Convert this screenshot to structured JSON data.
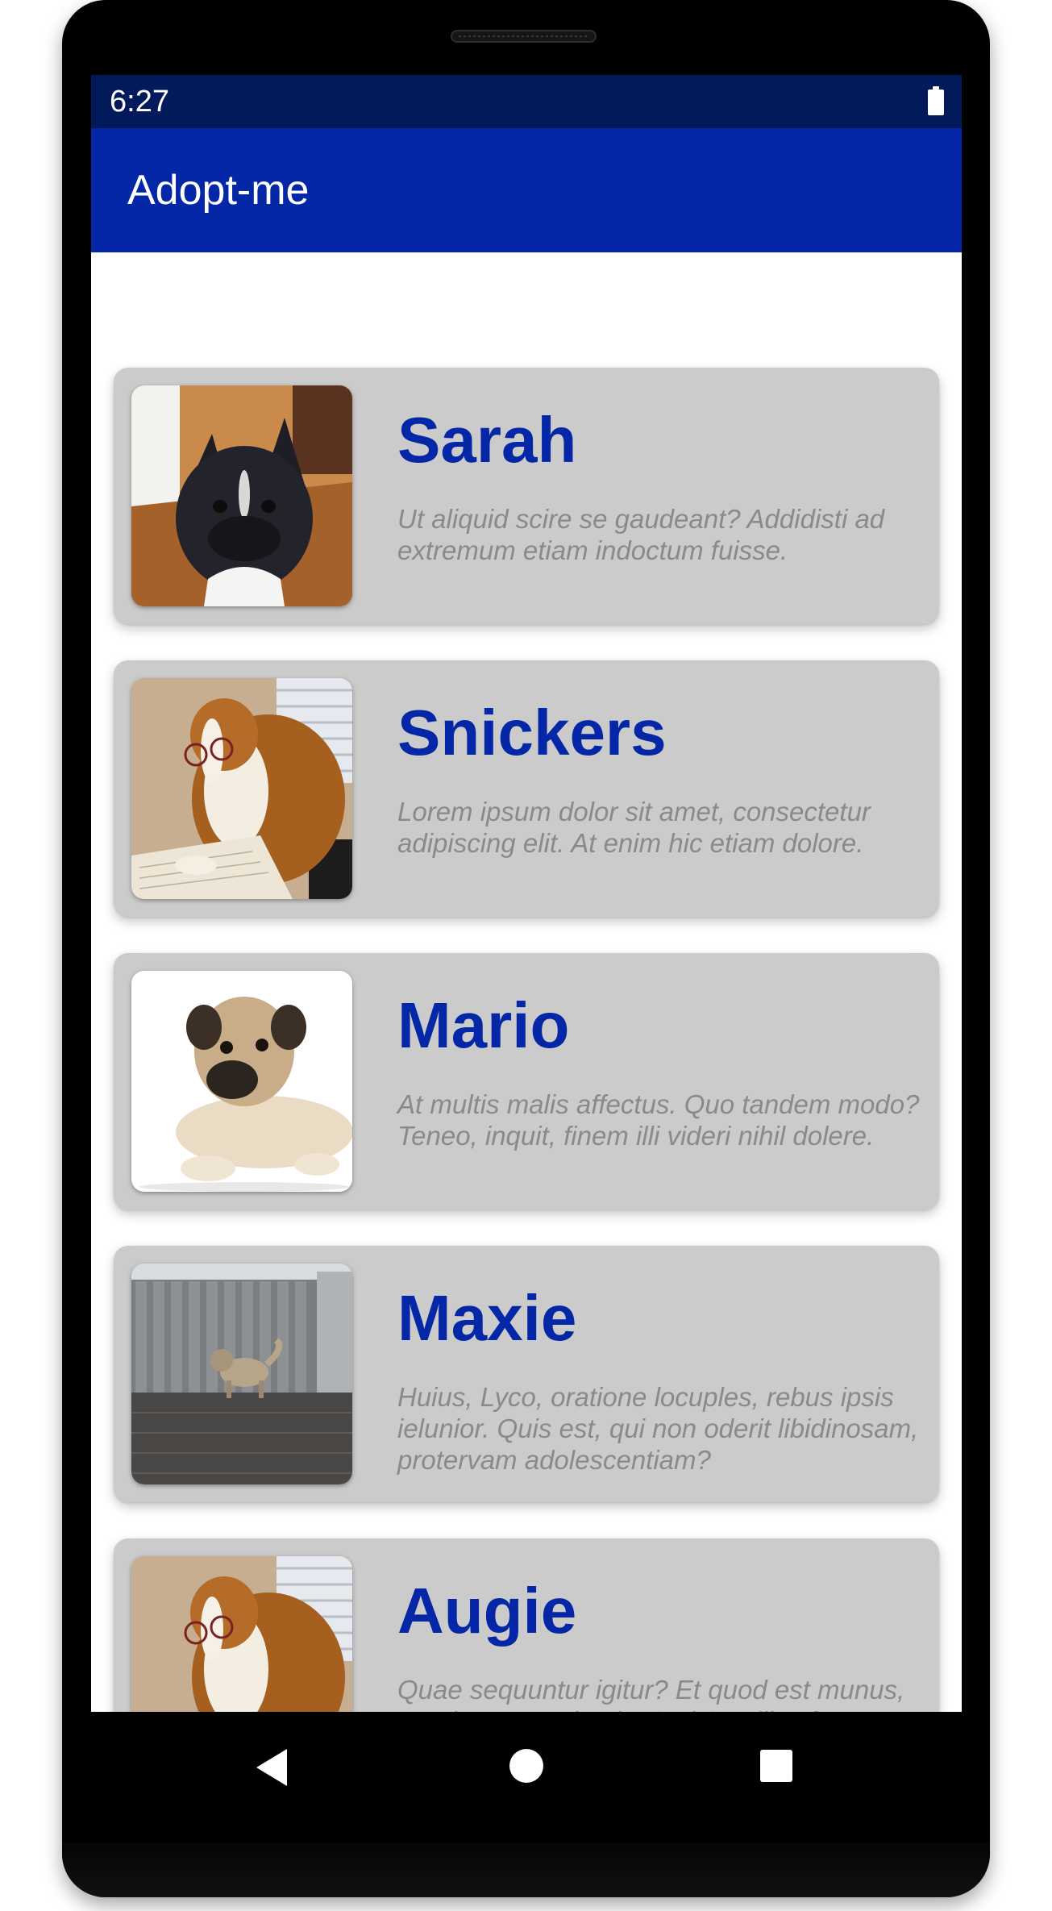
{
  "status_bar": {
    "time": "6:27",
    "battery_icon": "battery-full-icon"
  },
  "app_bar": {
    "title": "Adopt-me"
  },
  "pets": [
    {
      "name": "Sarah",
      "description": "Ut aliquid scire se gaudeant? Addidisti ad extremum etiam indoctum fuisse.",
      "photo": "french-bulldog-photo"
    },
    {
      "name": "Snickers",
      "description": "Lorem ipsum dolor sit amet, consectetur adipiscing elit. At enim hic etiam dolore.",
      "photo": "dog-with-glasses-photo"
    },
    {
      "name": "Mario",
      "description": "At multis malis affectus. Quo tandem modo? Teneo, inquit, finem illi videri nihil dolere.",
      "photo": "pug-photo"
    },
    {
      "name": "Maxie",
      "description": "Huius, Lyco, oratione locuples, rebus ipsis ielunior. Quis est, qui non oderit libidinosam, protervam adolescentiam?",
      "photo": "dog-by-gate-photo"
    },
    {
      "name": "Augie",
      "description": "Quae sequuntur igitur? Et quod est munus, quod opus sapientiae? Id Sextilius factum negabat.",
      "photo": "dog-with-glasses-photo"
    }
  ],
  "nav_bar": {
    "back_icon": "back-triangle-icon",
    "home_icon": "home-circle-icon",
    "recents_icon": "recents-square-icon"
  },
  "colors": {
    "status_bar": "#021A5C",
    "app_bar": "#0327A6",
    "card_background": "#CBCBCB",
    "pet_name": "#0327A6",
    "description": "#8A8A8A"
  }
}
